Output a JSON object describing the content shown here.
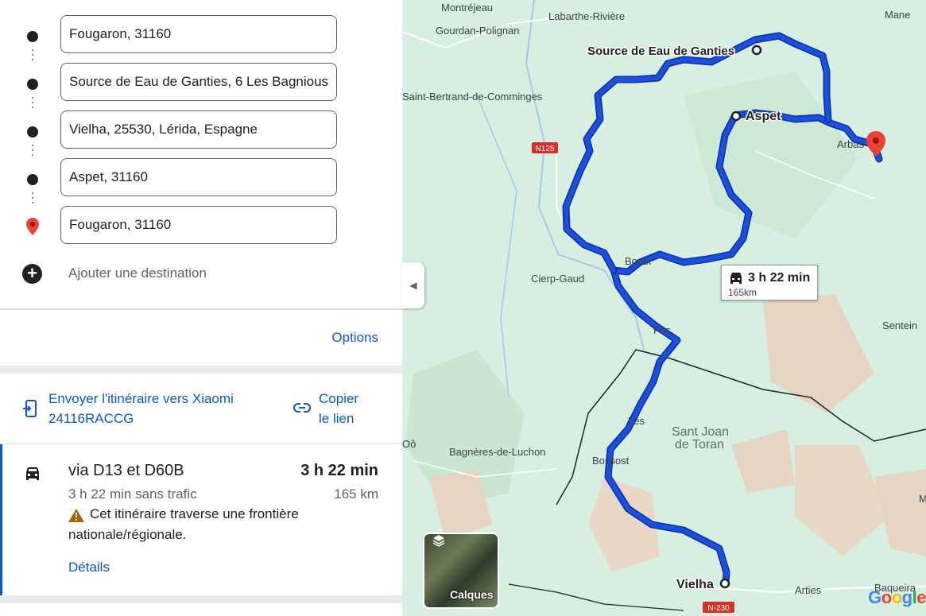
{
  "directions": {
    "stops": [
      {
        "value": "Fougaron, 31160",
        "type": "dot"
      },
      {
        "value": "Source de Eau de Ganties, 6 Les Bagnious",
        "type": "dot"
      },
      {
        "value": "Vielha, 25530, Lérida, Espagne",
        "type": "dot"
      },
      {
        "value": "Aspet, 31160",
        "type": "dot"
      },
      {
        "value": "Fougaron, 31160",
        "type": "destination-pin"
      }
    ],
    "add_destination": "Ajouter une destination",
    "options": "Options"
  },
  "send": {
    "send_line1": "Envoyer l'itinéraire vers Xiaomi",
    "send_line2": "24116RACCG",
    "copy_line1": "Copier",
    "copy_line2": "le lien"
  },
  "route": {
    "via": "via D13 et D60B",
    "duration": "3 h 22 min",
    "no_traffic": "3 h 22 min sans trafic",
    "distance": "165 km",
    "warning_line1": "Cet itinéraire traverse une frontière",
    "warning_line2": "nationale/régionale.",
    "details": "Détails"
  },
  "map": {
    "places": {
      "montrejeau": "Montréjeau",
      "labarthe": "Labarthe-Rivière",
      "mane": "Mane",
      "gourdan": "Gourdan-Polignan",
      "source": "Source de Eau de Ganties",
      "saint_bertrand": "Saint-Bertrand-de-Comminges",
      "aspet": "Aspet",
      "arbas": "Arbas",
      "boutx": "Boutx",
      "cierp": "Cierp-Gaud",
      "fos": "Fos",
      "sentein": "Sentein",
      "les": "Les",
      "sant_joan_1": "Sant Joan",
      "sant_joan_2": "de Toran",
      "oo": "Oô",
      "bagneres": "Bagnères-de-Luchon",
      "bossost": "Bossost",
      "vielha": "Vielha",
      "arties": "Arties",
      "baqueira": "Baqueira",
      "m": "M"
    },
    "roads": {
      "n125": "N125",
      "n230": "N-230"
    },
    "duration_box": {
      "time": "3 h 22 min",
      "distance": "165km"
    },
    "layers_label": "Calques",
    "logo": "Google",
    "route_color": "#1a4fe0",
    "pin_color": "#ea4335"
  }
}
